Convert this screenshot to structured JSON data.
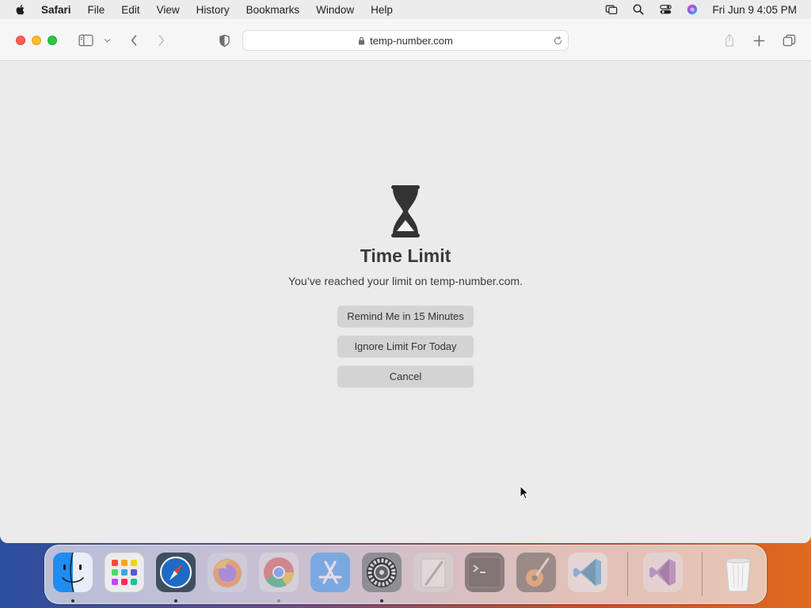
{
  "menubar": {
    "apple_icon": "apple-logo-icon",
    "app_name": "Safari",
    "items": [
      "File",
      "Edit",
      "View",
      "History",
      "Bookmarks",
      "Window",
      "Help"
    ],
    "clock": "Fri Jun 9  4:05 PM",
    "status_icons": [
      "screen-mirroring-icon",
      "spotlight-search-icon",
      "control-center-icon",
      "siri-icon"
    ]
  },
  "toolbar": {
    "url": "temp-number.com",
    "icons": [
      "sidebar-toggle-icon",
      "chevron-down-icon",
      "back-arrow-icon",
      "forward-arrow-icon",
      "privacy-shield-icon",
      "lock-icon",
      "reload-icon",
      "share-icon",
      "new-tab-plus-icon",
      "tab-overview-icon"
    ]
  },
  "content": {
    "icon": "hourglass-icon",
    "title": "Time Limit",
    "subtitle": "You’ve reached your limit on temp-number.com.",
    "buttons": {
      "remind": "Remind Me in 15 Minutes",
      "ignore": "Ignore Limit For Today",
      "cancel": "Cancel"
    }
  },
  "dock": {
    "apps": [
      "Finder",
      "Launchpad",
      "Safari",
      "Firefox",
      "Chrome",
      "App Store",
      "System Preferences",
      "Script Editor",
      "Terminal",
      "Instruments",
      "Visual Studio Code",
      "Visual Studio",
      "Trash"
    ]
  },
  "colors": {
    "close": "#fe5f57",
    "minimize": "#febc2e",
    "maximize": "#28c840",
    "content_bg": "#ebebeb",
    "button_bg": "#d3d3d3",
    "title_text": "#3a3a3a"
  }
}
